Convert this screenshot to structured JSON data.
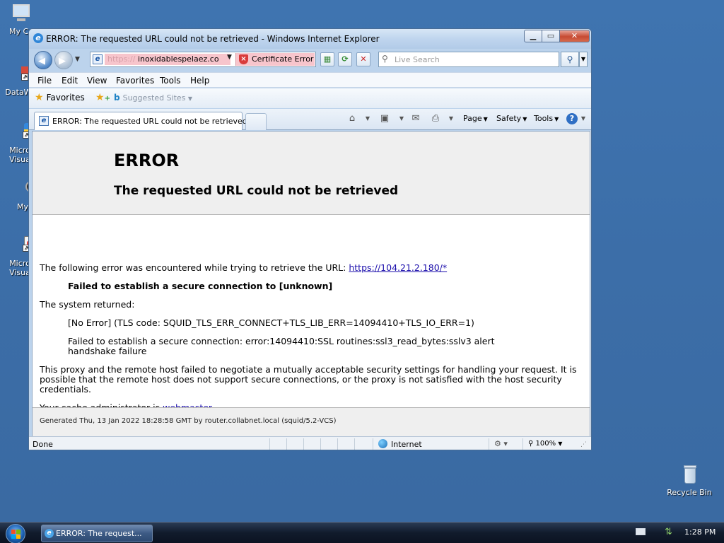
{
  "desktop": {
    "icons": [
      {
        "label": "My Co"
      },
      {
        "label": "DataW"
      },
      {
        "label": "Micro",
        "label2": "Visua"
      },
      {
        "label": "My"
      },
      {
        "label": "Micro",
        "label2": "Visua"
      },
      {
        "label": "Recycle Bin"
      }
    ]
  },
  "window": {
    "title": "ERROR: The requested URL could not be retrieved - Windows Internet Explorer",
    "address": {
      "protocol": "https://",
      "host": "inoxidablespelaez.co",
      "cert_error_label": "Certificate Error"
    },
    "search": {
      "placeholder": "Live Search"
    },
    "menu": [
      "File",
      "Edit",
      "View",
      "Favorites",
      "Tools",
      "Help"
    ],
    "favorites_bar": {
      "favorites_label": "Favorites",
      "suggested_sites_label": "Suggested Sites"
    },
    "tab": {
      "title": "ERROR: The requested URL could not be retrieved"
    },
    "command_bar": {
      "page_label": "Page",
      "safety_label": "Safety",
      "tools_label": "Tools"
    },
    "status_bar": {
      "status": "Done",
      "zone": "Internet",
      "zoom": "100%"
    }
  },
  "page": {
    "heading": "ERROR",
    "subheading": "The requested URL could not be retrieved",
    "intro": "The following error was encountered while trying to retrieve the URL:",
    "url_link": "https://104.21.2.180/*",
    "error_summary": "Failed to establish a secure connection to [unknown]",
    "system_returned": "The system returned:",
    "tls_error": "[No Error] (TLS code: SQUID_TLS_ERR_CONNECT+TLS_LIB_ERR=14094410+TLS_IO_ERR=1)",
    "ssl_error_line1": "Failed to establish a secure connection: error:14094410:SSL routines:ssl3_read_bytes:sslv3 alert",
    "ssl_error_line2": "handshake failure",
    "explanation_line1": "This proxy and the remote host failed to negotiate a mutually acceptable security settings for handling your request. It is",
    "explanation_line2": "possible that the remote host does not support secure connections, or the proxy is not satisfied with the host security",
    "explanation_line3": "credentials.",
    "admin_prefix": "Your cache administrator is",
    "admin_link": "webmaster",
    "admin_suffix": ".",
    "generated": "Generated Thu, 13 Jan 2022 18:28:58 GMT by router.collabnet.local (squid/5.2-VCS)"
  },
  "taskbar": {
    "task_label": "ERROR: The request...",
    "clock": "1:28 PM"
  },
  "colors": {
    "desktop": "#3c6ea8",
    "cert_error_bg": "#f7c5cc",
    "link": "#1a0dab"
  }
}
